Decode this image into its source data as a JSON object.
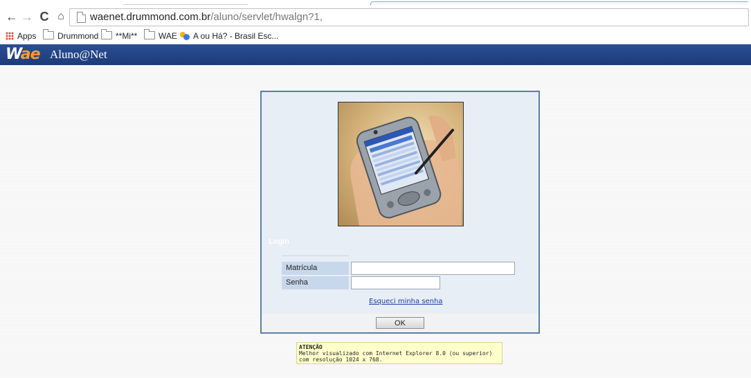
{
  "browser": {
    "url_host": "waenet.drummond.com.br",
    "url_path": "/aluno/servlet/hwalgn?1,",
    "bookmarks": [
      {
        "label": "Apps",
        "icon": "apps-grid-icon"
      },
      {
        "label": "Drummond",
        "icon": "folder-icon"
      },
      {
        "label": "**Mi**",
        "icon": "folder-icon"
      },
      {
        "label": "WAE",
        "icon": "folder-icon"
      },
      {
        "label": "A ou Há? - Brasil Esc...",
        "icon": "site-favicon"
      }
    ],
    "nav_icons": [
      "back-arrow-icon",
      "forward-arrow-icon",
      "reload-icon",
      "home-icon"
    ]
  },
  "header": {
    "logo_w": "W",
    "logo_ae": "ae",
    "title": "Aluno@Net",
    "background": "#1d3b78"
  },
  "login": {
    "legend": "Login",
    "fields": [
      {
        "label": "Matrícula",
        "value": ""
      },
      {
        "label": "Senha",
        "value": ""
      }
    ],
    "forgot_link": "Esqueci minha senha",
    "ok_button": "OK"
  },
  "notice": {
    "title": "ATENÇÃO",
    "text": "Melhor visualizado com Internet Explorer 8.0 (ou superior) com resolução 1024 x 768."
  }
}
